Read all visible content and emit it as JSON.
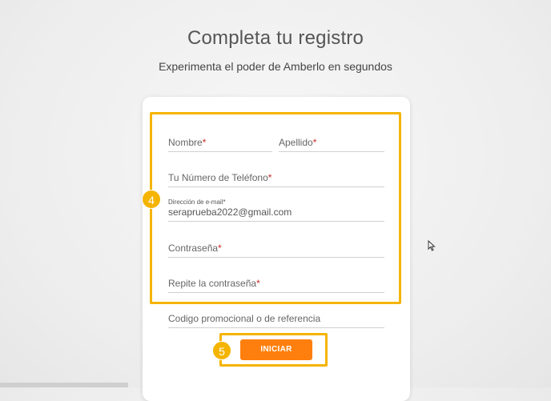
{
  "header": {
    "title": "Completa tu registro",
    "subtitle": "Experimenta el poder de Amberlo en segundos"
  },
  "form": {
    "first_name_label": "Nombre",
    "last_name_label": "Apellido",
    "phone_label": "Tu Número de Teléfono",
    "email_label": "Dirección de e-mail",
    "email_value": "seraprueba2022@gmail.com",
    "password_label": "Contraseña",
    "repeat_password_label": "Repite la contraseña",
    "promo_label": "Codigo promocional o de referencia",
    "required_marker": "*",
    "submit_label": "INICIAR"
  },
  "annotations": {
    "step_fields": "4",
    "step_button": "5",
    "highlight_color": "#f5b400"
  },
  "colors": {
    "button": "#ff7f0e",
    "required": "#c62828"
  }
}
